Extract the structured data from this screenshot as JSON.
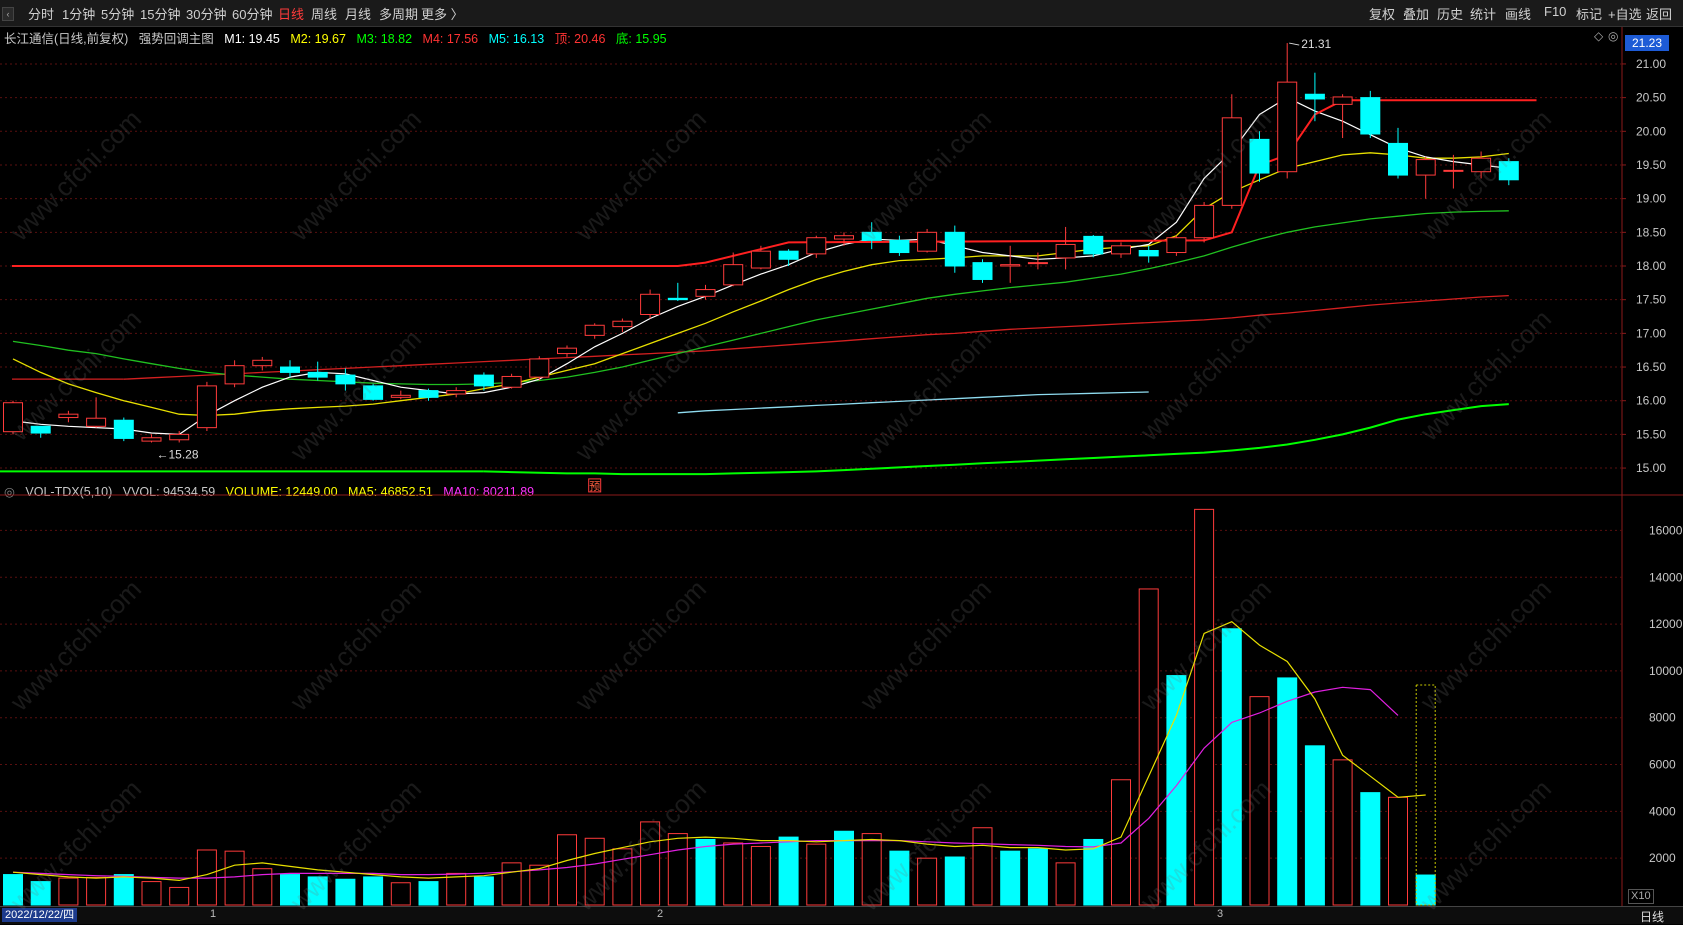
{
  "toolbar": {
    "periods": [
      "分时",
      "1分钟",
      "5分钟",
      "15分钟",
      "30分钟",
      "60分钟",
      "日线",
      "周线",
      "月线",
      "多周期",
      "更多 〉"
    ],
    "active_period": "日线",
    "actions": [
      "复权",
      "叠加",
      "历史",
      "统计",
      "画线",
      "F10",
      "标记",
      "+自选",
      "返回"
    ]
  },
  "main_info": {
    "stock": "长江通信(日线,前复权)",
    "indicator": "强势回调主图",
    "m1": "M1: 19.45",
    "m2": "M2: 19.67",
    "m3": "M3: 18.82",
    "m4": "M4: 17.56",
    "m5": "M5: 16.13",
    "top": "顶: 20.46",
    "bottom": "底: 15.95",
    "colors": {
      "m1": "#ffffff",
      "m2": "#ffff00",
      "m3": "#00ff00",
      "m4": "#ff3333",
      "m5": "#00ffff",
      "top": "#ff3333",
      "bottom": "#00ff00",
      "label": "#c8c8c8"
    }
  },
  "vol_info": {
    "name": "VOL-TDX(5,10)",
    "vvol": "VVOL: 94534.59",
    "volume": "VOLUME: 12449.00",
    "ma5": "MA5: 46852.51",
    "ma10": "MA10: 80211.89"
  },
  "current_price": "21.23",
  "high_annotation": "21.31",
  "low_annotation": "←15.28",
  "forecast_marker": "预",
  "bottom": {
    "date": "2022/12/22/四",
    "months": [
      "1",
      "2",
      "3"
    ],
    "period": "日线",
    "scale": "X10"
  },
  "watermark": "www.cfchi.com",
  "chart_data": {
    "type": "candlestick",
    "price_axis": {
      "ticks": [
        15.0,
        15.5,
        16.0,
        16.5,
        17.0,
        17.5,
        18.0,
        18.5,
        19.0,
        19.5,
        20.0,
        20.5,
        21.0
      ],
      "range": [
        14.6,
        21.4
      ]
    },
    "volume_axis": {
      "ticks": [
        2000,
        4000,
        6000,
        8000,
        10000,
        12000,
        14000,
        16000
      ],
      "range": [
        0,
        17300
      ]
    },
    "candles": [
      {
        "o": 15.54,
        "c": 15.97,
        "h": 16.0,
        "l": 15.5
      },
      {
        "o": 15.62,
        "c": 15.52,
        "h": 15.62,
        "l": 15.45
      },
      {
        "o": 15.75,
        "c": 15.8,
        "h": 15.85,
        "l": 15.68
      },
      {
        "o": 15.62,
        "c": 15.74,
        "h": 16.05,
        "l": 15.6
      },
      {
        "o": 15.71,
        "c": 15.44,
        "h": 15.75,
        "l": 15.4
      },
      {
        "o": 15.4,
        "c": 15.45,
        "h": 15.5,
        "l": 15.38
      },
      {
        "o": 15.42,
        "c": 15.5,
        "h": 15.55,
        "l": 15.38
      },
      {
        "o": 15.6,
        "c": 16.22,
        "h": 16.28,
        "l": 15.55
      },
      {
        "o": 16.25,
        "c": 16.52,
        "h": 16.6,
        "l": 16.2
      },
      {
        "o": 16.52,
        "c": 16.6,
        "h": 16.65,
        "l": 16.45
      },
      {
        "o": 16.5,
        "c": 16.42,
        "h": 16.6,
        "l": 16.35
      },
      {
        "o": 16.42,
        "c": 16.35,
        "h": 16.58,
        "l": 16.3
      },
      {
        "o": 16.38,
        "c": 16.25,
        "h": 16.48,
        "l": 16.15
      },
      {
        "o": 16.22,
        "c": 16.02,
        "h": 16.25,
        "l": 16.0
      },
      {
        "o": 16.05,
        "c": 16.08,
        "h": 16.15,
        "l": 16.02
      },
      {
        "o": 16.15,
        "c": 16.05,
        "h": 16.18,
        "l": 16.0
      },
      {
        "o": 16.1,
        "c": 16.15,
        "h": 16.2,
        "l": 16.05
      },
      {
        "o": 16.38,
        "c": 16.22,
        "h": 16.42,
        "l": 16.15
      },
      {
        "o": 16.2,
        "c": 16.36,
        "h": 16.4,
        "l": 16.18
      },
      {
        "o": 16.35,
        "c": 16.62,
        "h": 16.66,
        "l": 16.3
      },
      {
        "o": 16.7,
        "c": 16.78,
        "h": 16.82,
        "l": 16.65
      },
      {
        "o": 16.97,
        "c": 17.12,
        "h": 17.15,
        "l": 16.92
      },
      {
        "o": 17.1,
        "c": 17.18,
        "h": 17.22,
        "l": 17.02
      },
      {
        "o": 17.28,
        "c": 17.58,
        "h": 17.65,
        "l": 17.22
      },
      {
        "o": 17.52,
        "c": 17.5,
        "h": 17.75,
        "l": 17.48
      },
      {
        "o": 17.55,
        "c": 17.65,
        "h": 17.72,
        "l": 17.5
      },
      {
        "o": 17.72,
        "c": 18.02,
        "h": 18.2,
        "l": 17.7
      },
      {
        "o": 17.97,
        "c": 18.22,
        "h": 18.3,
        "l": 17.95
      },
      {
        "o": 18.22,
        "c": 18.1,
        "h": 18.25,
        "l": 18.0
      },
      {
        "o": 18.18,
        "c": 18.42,
        "h": 18.45,
        "l": 18.12
      },
      {
        "o": 18.4,
        "c": 18.45,
        "h": 18.5,
        "l": 18.3
      },
      {
        "o": 18.5,
        "c": 18.38,
        "h": 18.65,
        "l": 18.25
      },
      {
        "o": 18.38,
        "c": 18.2,
        "h": 18.45,
        "l": 18.15
      },
      {
        "o": 18.22,
        "c": 18.5,
        "h": 18.55,
        "l": 18.2
      },
      {
        "o": 18.5,
        "c": 18.0,
        "h": 18.6,
        "l": 17.9
      },
      {
        "o": 18.05,
        "c": 17.8,
        "h": 18.1,
        "l": 17.75
      },
      {
        "o": 18.0,
        "c": 18.02,
        "h": 18.3,
        "l": 17.75
      },
      {
        "o": 18.05,
        "c": 18.05,
        "h": 18.2,
        "l": 17.95
      },
      {
        "o": 18.12,
        "c": 18.32,
        "h": 18.58,
        "l": 17.95
      },
      {
        "o": 18.44,
        "c": 18.18,
        "h": 18.46,
        "l": 18.13
      },
      {
        "o": 18.18,
        "c": 18.3,
        "h": 18.35,
        "l": 18.12
      },
      {
        "o": 18.23,
        "c": 18.15,
        "h": 18.3,
        "l": 18.05
      },
      {
        "o": 18.2,
        "c": 18.42,
        "h": 18.45,
        "l": 18.15
      },
      {
        "o": 18.42,
        "c": 18.9,
        "h": 18.95,
        "l": 18.35
      },
      {
        "o": 18.9,
        "c": 20.2,
        "h": 20.55,
        "l": 18.85
      },
      {
        "o": 19.88,
        "c": 19.38,
        "h": 20.0,
        "l": 19.25
      },
      {
        "o": 19.4,
        "c": 20.73,
        "h": 21.31,
        "l": 19.3
      },
      {
        "o": 20.55,
        "c": 20.48,
        "h": 20.87,
        "l": 20.15
      },
      {
        "o": 20.4,
        "c": 20.51,
        "h": 20.55,
        "l": 19.9
      },
      {
        "o": 20.5,
        "c": 19.96,
        "h": 20.6,
        "l": 19.9
      },
      {
        "o": 19.82,
        "c": 19.35,
        "h": 20.05,
        "l": 19.3
      },
      {
        "o": 19.35,
        "c": 19.58,
        "h": 19.62,
        "l": 19.0
      },
      {
        "o": 19.42,
        "c": 19.42,
        "h": 19.65,
        "l": 19.15
      },
      {
        "o": 19.4,
        "c": 19.6,
        "h": 19.7,
        "l": 19.3
      },
      {
        "o": 19.55,
        "c": 19.28,
        "h": 19.6,
        "l": 19.2
      }
    ],
    "volumes": [
      1300,
      1000,
      1150,
      1180,
      1300,
      1000,
      750,
      2350,
      2300,
      1550,
      1300,
      1200,
      1100,
      1200,
      950,
      1000,
      1350,
      1200,
      1800,
      1700,
      3000,
      2850,
      2400,
      3550,
      3050,
      2800,
      2650,
      2500,
      2900,
      2600,
      3150,
      3050,
      2300,
      2000,
      2050,
      3300,
      2300,
      2400,
      1800,
      2800,
      5350,
      13500,
      9800,
      16900,
      11800,
      8900,
      9700,
      6800,
      6200,
      4800,
      4600,
      1280
    ],
    "volume_up": [
      false,
      false,
      true,
      true,
      false,
      true,
      true,
      true,
      true,
      true,
      false,
      false,
      false,
      false,
      true,
      false,
      true,
      false,
      true,
      true,
      true,
      true,
      true,
      true,
      true,
      false,
      true,
      true,
      false,
      true,
      false,
      true,
      false,
      true,
      false,
      true,
      false,
      false,
      true,
      false,
      true,
      true,
      false,
      true,
      false,
      true,
      false,
      false,
      true,
      false,
      true,
      false
    ],
    "overlays": {
      "m1_white": [
        15.7,
        15.65,
        15.62,
        15.6,
        15.58,
        15.52,
        15.5,
        15.78,
        16.0,
        16.2,
        16.35,
        16.42,
        16.4,
        16.3,
        16.2,
        16.15,
        16.1,
        16.12,
        16.2,
        16.32,
        16.55,
        16.8,
        17.0,
        17.22,
        17.4,
        17.55,
        17.72,
        17.88,
        18.02,
        18.2,
        18.32,
        18.4,
        18.38,
        18.4,
        18.3,
        18.2,
        18.15,
        18.1,
        18.12,
        18.15,
        18.25,
        18.32,
        18.65,
        19.3,
        19.7,
        20.25,
        20.5,
        20.3,
        20.15,
        19.95,
        19.75,
        19.62,
        19.55,
        19.5,
        19.45
      ],
      "m2_yellow": [
        16.62,
        16.42,
        16.25,
        16.12,
        16.0,
        15.9,
        15.8,
        15.78,
        15.8,
        15.85,
        15.88,
        15.9,
        15.92,
        15.95,
        16.0,
        16.05,
        16.1,
        16.18,
        16.25,
        16.35,
        16.45,
        16.55,
        16.7,
        16.85,
        17.0,
        17.15,
        17.32,
        17.48,
        17.65,
        17.8,
        17.92,
        18.02,
        18.08,
        18.1,
        18.12,
        18.15,
        18.15,
        18.15,
        18.2,
        18.25,
        18.28,
        18.3,
        18.45,
        18.85,
        19.1,
        19.28,
        19.45,
        19.55,
        19.65,
        19.68,
        19.65,
        19.6,
        19.6,
        19.62,
        19.67
      ],
      "m3_green": [
        16.88,
        16.82,
        16.75,
        16.7,
        16.62,
        16.55,
        16.48,
        16.42,
        16.38,
        16.35,
        16.32,
        16.3,
        16.28,
        16.26,
        16.25,
        16.24,
        16.24,
        16.25,
        16.27,
        16.3,
        16.35,
        16.42,
        16.5,
        16.6,
        16.7,
        16.8,
        16.9,
        17.0,
        17.1,
        17.2,
        17.28,
        17.36,
        17.44,
        17.52,
        17.58,
        17.63,
        17.68,
        17.72,
        17.76,
        17.82,
        17.88,
        17.96,
        18.05,
        18.15,
        18.28,
        18.4,
        18.5,
        18.58,
        18.64,
        18.7,
        18.74,
        18.78,
        18.8,
        18.81,
        18.82
      ],
      "m4_red": [
        16.32,
        16.34,
        16.36,
        16.38,
        16.4,
        16.42,
        16.44,
        16.46,
        16.48,
        16.5,
        16.52,
        16.54,
        16.56,
        16.58,
        16.6,
        16.62,
        16.64,
        16.66,
        16.68,
        16.7,
        16.72,
        16.74,
        16.77,
        16.8,
        16.83,
        16.86,
        16.89,
        16.92,
        16.95,
        16.98,
        17.0,
        17.03,
        17.06,
        17.08,
        17.1,
        17.12,
        17.14,
        17.16,
        17.18,
        17.2,
        17.23,
        17.27,
        17.3,
        17.34,
        17.38,
        17.42,
        17.45,
        17.48,
        17.51,
        17.54,
        17.56
      ],
      "m5_cyan_start_index": 24,
      "m5_cyan": [
        15.82,
        15.85,
        15.87,
        15.89,
        15.91,
        15.93,
        15.95,
        15.97,
        15.99,
        16.01,
        16.03,
        16.05,
        16.07,
        16.09,
        16.1,
        16.11,
        16.12,
        16.13
      ],
      "base_green": [
        14.95,
        14.94,
        14.93,
        14.92,
        14.92,
        14.91,
        14.91,
        14.91,
        14.91,
        14.92,
        14.93,
        14.94,
        14.95,
        14.97,
        14.99,
        15.01,
        15.03,
        15.05,
        15.07,
        15.09,
        15.11,
        15.13,
        15.15,
        15.17,
        15.19,
        15.21,
        15.23,
        15.26,
        15.3,
        15.35,
        15.42,
        15.5,
        15.6,
        15.72,
        15.8,
        15.86,
        15.92,
        15.95
      ],
      "top_line": {
        "left_level": 18.0,
        "step_index": 20,
        "right_level": 18.38,
        "spike_index": 44,
        "final_level": 20.46
      },
      "vol_ma5": [
        1400,
        1300,
        1200,
        1150,
        1200,
        1150,
        1050,
        1300,
        1700,
        1800,
        1650,
        1500,
        1400,
        1300,
        1200,
        1150,
        1200,
        1250,
        1400,
        1550,
        1900,
        2200,
        2450,
        2700,
        2850,
        2900,
        2850,
        2750,
        2750,
        2700,
        2750,
        2800,
        2750,
        2600,
        2500,
        2550,
        2450,
        2450,
        2350,
        2400,
        2900,
        5500,
        8100,
        11600,
        12100,
        11100,
        10400,
        8800,
        6400,
        5500,
        4600,
        4700
      ],
      "vol_ma10": [
        1400,
        1350,
        1300,
        1250,
        1220,
        1180,
        1150,
        1150,
        1200,
        1300,
        1350,
        1350,
        1350,
        1350,
        1300,
        1300,
        1320,
        1360,
        1420,
        1500,
        1600,
        1750,
        1950,
        2150,
        2350,
        2500,
        2600,
        2650,
        2700,
        2750,
        2750,
        2750,
        2750,
        2700,
        2650,
        2620,
        2580,
        2550,
        2500,
        2480,
        2650,
        3700,
        5100,
        6700,
        7800,
        8200,
        8700,
        9100,
        9300,
        9200,
        8100
      ]
    }
  }
}
